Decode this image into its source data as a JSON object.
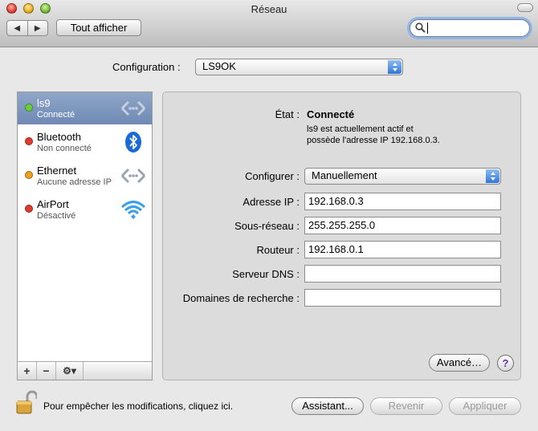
{
  "window": {
    "title": "Réseau"
  },
  "toolbar": {
    "show_all_label": "Tout afficher",
    "back_glyph": "◀",
    "forward_glyph": "▶",
    "search_value": ""
  },
  "configuration": {
    "label": "Configuration :",
    "value": "LS9OK"
  },
  "services": [
    {
      "name": "ls9",
      "status": "Connecté",
      "dot_color": "#6fcf3b",
      "icon": "ethernet-icon"
    },
    {
      "name": "Bluetooth",
      "status": "Non connecté",
      "dot_color": "#e23b2e",
      "icon": "bluetooth-icon"
    },
    {
      "name": "Ethernet",
      "status": "Aucune adresse IP",
      "dot_color": "#f0a020",
      "icon": "ethernet-icon"
    },
    {
      "name": "AirPort",
      "status": "Désactivé",
      "dot_color": "#e23b2e",
      "icon": "wifi-icon"
    }
  ],
  "sidebar_actions": {
    "add": "+",
    "remove": "−",
    "gear": "⚙▾"
  },
  "detail": {
    "state_label": "État :",
    "state_value": "Connecté",
    "state_desc_line1": "ls9 est actuellement actif et",
    "state_desc_line2": "possède l'adresse IP 192.168.0.3.",
    "configure_label": "Configurer :",
    "configure_value": "Manuellement",
    "ip_label": "Adresse IP :",
    "ip_value": "192.168.0.3",
    "subnet_label": "Sous-réseau :",
    "subnet_value": "255.255.255.0",
    "router_label": "Routeur :",
    "router_value": "192.168.0.1",
    "dns_label": "Serveur DNS :",
    "dns_value": "",
    "search_domains_label": "Domaines de recherche :",
    "search_domains_value": "",
    "advanced_button": "Avancé…",
    "help_glyph": "?"
  },
  "footer": {
    "lock_text": "Pour empêcher les modifications, cliquez ici.",
    "assistant_button": "Assistant...",
    "revert_button": "Revenir",
    "apply_button": "Appliquer"
  }
}
